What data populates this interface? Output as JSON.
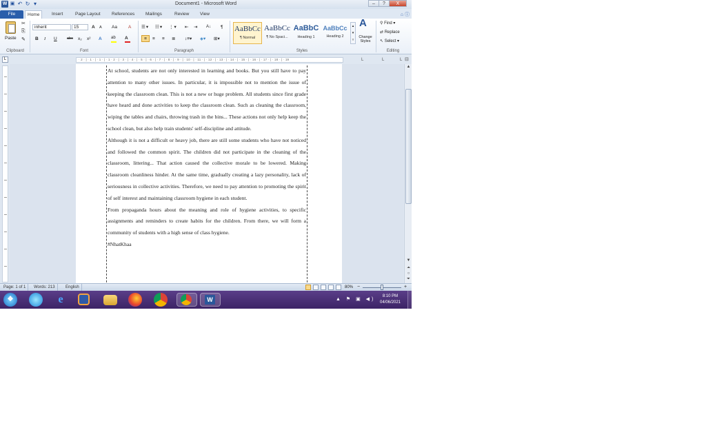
{
  "window": {
    "title": "Document1 - Microsoft Word",
    "minimize": "–",
    "maximize": "?",
    "close": "X"
  },
  "quick_access": {
    "logo": "W",
    "save": "💾",
    "undo": "↶",
    "redo": "↻",
    "more": "▾"
  },
  "tabs": [
    "File",
    "Home",
    "Insert",
    "Page Layout",
    "References",
    "Mailings",
    "Review",
    "View"
  ],
  "ribbon": {
    "clipboard": {
      "paste_label": "Paste",
      "label": "Clipboard"
    },
    "font": {
      "font_name": "inherit",
      "font_size": "15",
      "grow": "A",
      "shrink": "A",
      "case": "Aa",
      "clear": "A",
      "bold": "B",
      "italic": "I",
      "underline": "U",
      "strike": "abc",
      "subscript": "x₂",
      "superscript": "x²",
      "effects": "A",
      "highlight": "ab",
      "color": "A",
      "label": "Font"
    },
    "paragraph": {
      "label": "Paragraph",
      "show_marks": "¶",
      "sort": "A↓"
    },
    "styles": {
      "items": [
        {
          "sample": "AaBbCc",
          "name": "¶ Normal"
        },
        {
          "sample": "AaBbCc",
          "name": "¶ No Spaci..."
        },
        {
          "sample": "AaBbC",
          "name": "Heading 1"
        },
        {
          "sample": "AaBbCc",
          "name": "Heading 2"
        }
      ],
      "change_styles": "Change Styles",
      "label": "Styles"
    },
    "editing": {
      "find": "Find",
      "replace": "Replace",
      "select": "Select",
      "label": "Editing"
    }
  },
  "ruler": {
    "marks": "· 2 · | · 1 · | · 1 · | · 1 · 2 · | · 3 · | · 4 · | · 5 · | · 6 · | · 7 · | · 8 · | · 9 · | · 10 · | · 11 · | · 12 · | · 13 · | · 14 · | · 15 · | · 16 · | · 17 · | · 18 · | · 19",
    "tab_selector": "L"
  },
  "document": {
    "paragraphs": [
      "At school, students are not only interested in learning and books. But you still have to pay attention to many other issues. In particular, it is impossible not to mention the issue of keeping the classroom clean. This is not a new or huge problem. All students since first grade have heard and done activities to keep the classroom clean. Such as cleaning the classroom, wiping the tables and chairs, throwing trash in the bins... These actions not only help keep the school clean, but also help train students' self-discipline and attitude.",
      "Although it is not a difficult or heavy job, there are still some students who have not noticed and followed the common spirit. The children did not participate in the cleaning of the classroom, littering... That action caused the collective morale to be lowered. Making classroom cleanliness hinder. At the same time, gradually creating a lazy personality, lack of seriousness in collective activities. Therefore, we need to pay attention to promoting the spirit of self interest and maintaining classroom hygiene in each student.",
      "From propaganda hours about the meaning and role of hygiene activities, to specific assignments and reminders to create habits for the children. From there, we will form a community of students with a high sense of class hygiene.",
      "#NhatKhaa"
    ]
  },
  "statusbar": {
    "page": "Page: 1 of 1",
    "words": "Words: 213",
    "language": "English",
    "zoom": "80%",
    "zoom_level": 0.5,
    "zoom_minus": "−",
    "zoom_plus": "+"
  },
  "taskbar": {
    "time": "8:10 PM",
    "date": "04/06/2021",
    "tray": "▲ ⚑ ▣ ◀)",
    "apps": [
      "windows-start",
      "browser-globe",
      "internet-explorer",
      "media-player",
      "file-explorer",
      "firefox",
      "chrome",
      "chrome-profile",
      "word"
    ]
  },
  "colors": {
    "file_tab": "#2a5eab",
    "taskbar": "#4a2f75",
    "word_blue": "#2b579a"
  }
}
